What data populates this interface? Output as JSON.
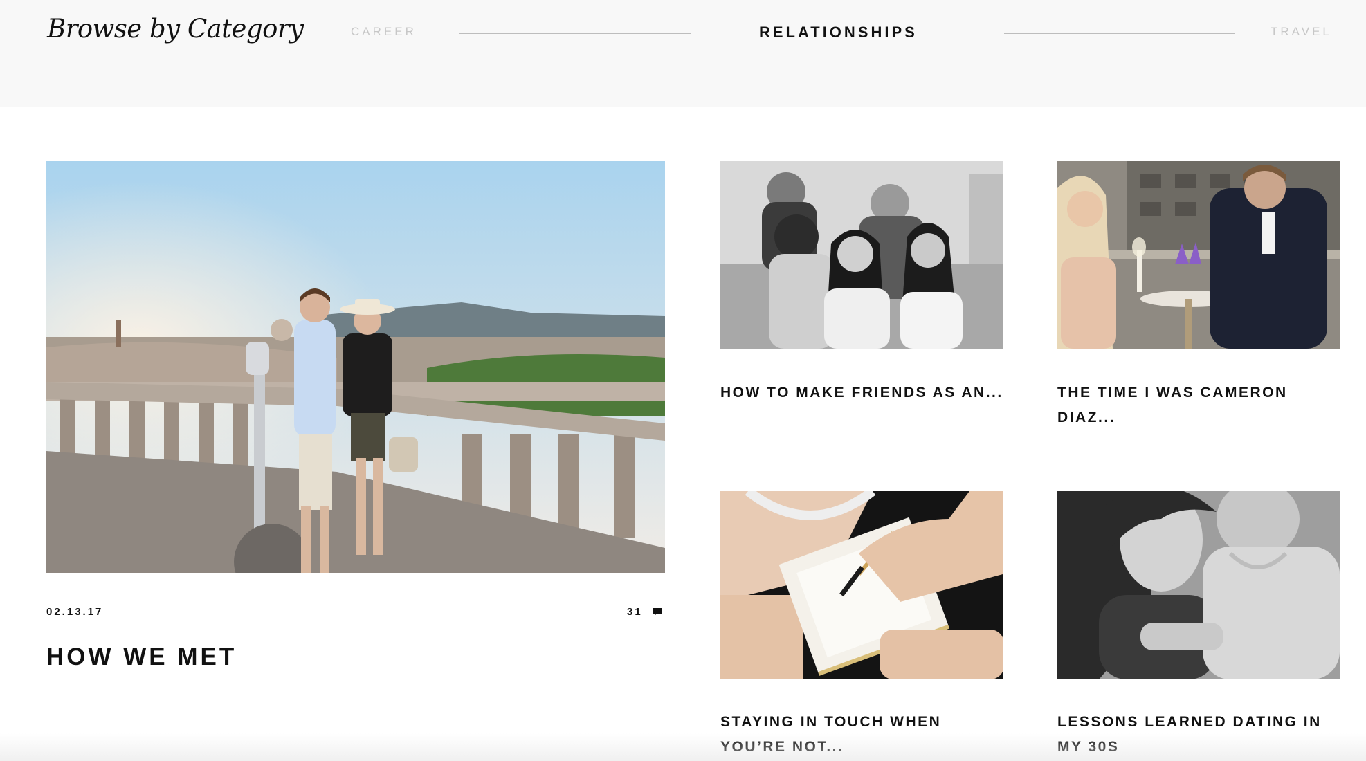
{
  "header": {
    "brand": "Browse by Category",
    "categories": [
      {
        "label": "CAREER",
        "active": false
      },
      {
        "label": "RELATIONSHIPS",
        "active": true
      },
      {
        "label": "TRAVEL",
        "active": false
      }
    ]
  },
  "featured": {
    "date": "02.13.17",
    "comment_count": "31",
    "title": "HOW WE MET"
  },
  "posts": [
    {
      "title": "HOW TO MAKE FRIENDS AS AN..."
    },
    {
      "title": "THE TIME I WAS CAMERON DIAZ..."
    },
    {
      "title": "STAYING IN TOUCH WHEN YOU’RE NOT..."
    },
    {
      "title": "LESSONS LEARNED DATING IN MY 30S"
    }
  ],
  "colors": {
    "header_bg": "#f8f8f8",
    "text": "#111111",
    "inactive_category": "#c7c7c7",
    "divider": "#bdbdbd"
  }
}
